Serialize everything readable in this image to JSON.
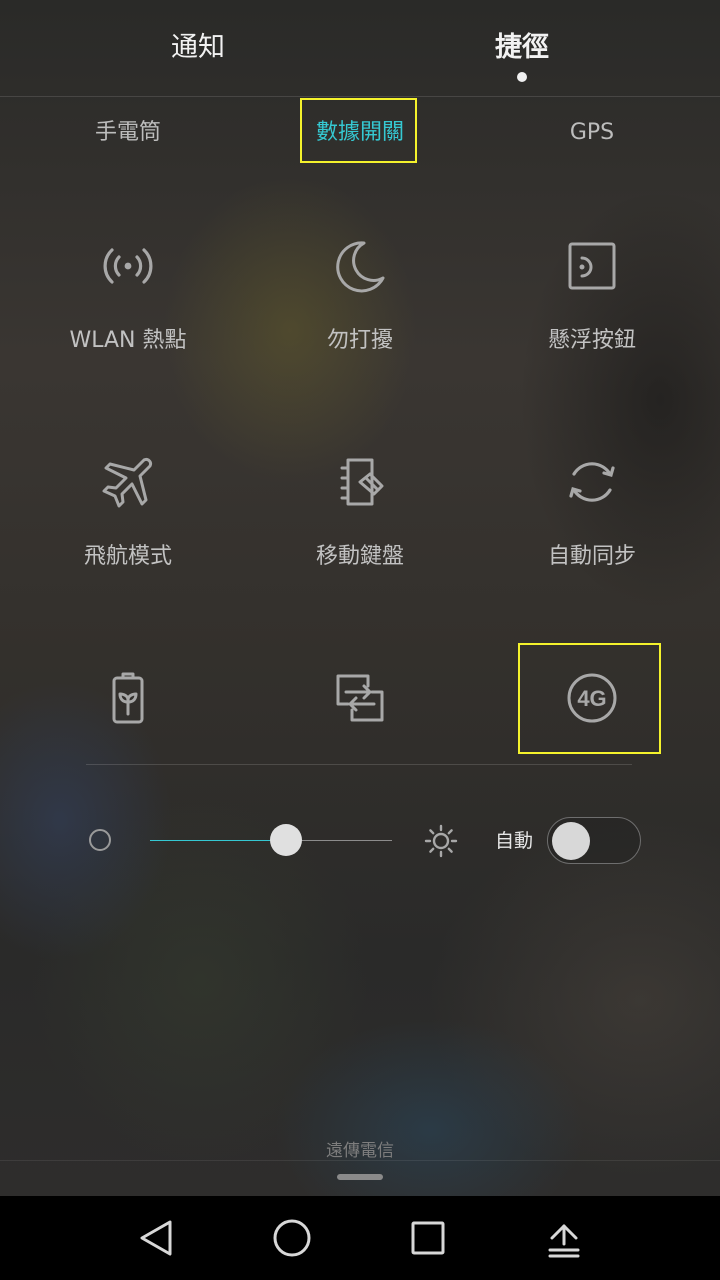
{
  "header": {
    "tabs": [
      {
        "label": "通知"
      },
      {
        "label": "捷徑"
      }
    ]
  },
  "text_toggles": [
    {
      "label": "手電筒"
    },
    {
      "label": "數據開關",
      "active": true
    },
    {
      "label": "GPS"
    }
  ],
  "tiles": [
    {
      "label": "WLAN 熱點",
      "icon": "hotspot-icon"
    },
    {
      "label": "勿打擾",
      "icon": "moon-icon"
    },
    {
      "label": "懸浮按鈕",
      "icon": "floating-button-icon"
    },
    {
      "label": "飛航模式",
      "icon": "airplane-icon"
    },
    {
      "label": "移動鍵盤",
      "icon": "mobile-keyboard-icon"
    },
    {
      "label": "自動同步",
      "icon": "sync-icon"
    },
    {
      "label": "",
      "icon": "battery-saver-icon"
    },
    {
      "label": "",
      "icon": "screen-switch-icon"
    },
    {
      "label": "",
      "icon": "4g-icon",
      "icon_text": "4G"
    }
  ],
  "brightness": {
    "level_percent": 56,
    "auto_label": "自動",
    "auto_enabled": false
  },
  "carrier": "遠傳電信",
  "colors": {
    "accent": "#35c8d2",
    "highlight": "#f4f22c",
    "icon": "#a8a8a8",
    "label": "#c2c2c2"
  }
}
